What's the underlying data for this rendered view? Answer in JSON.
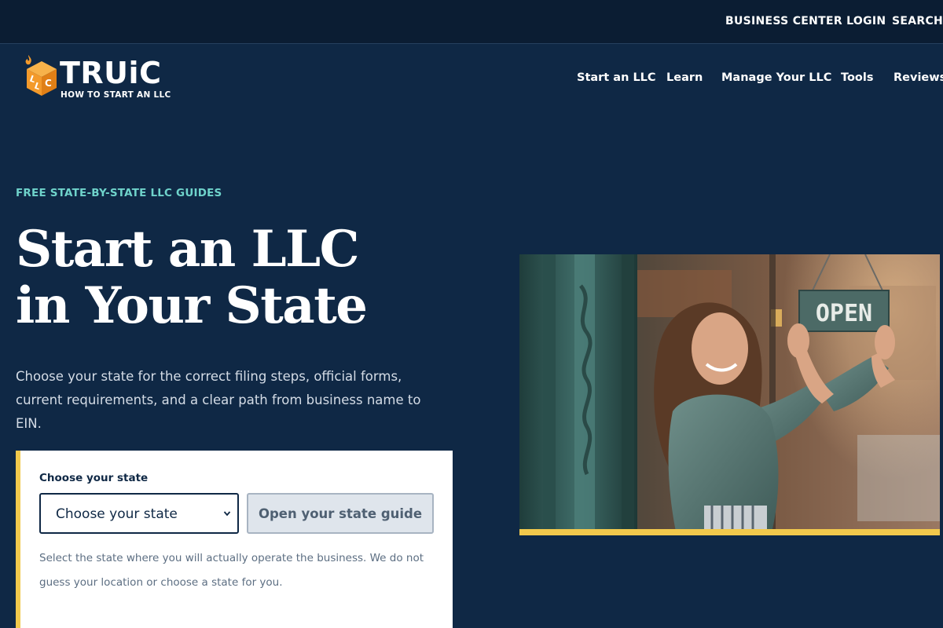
{
  "utility_nav": {
    "login": "BUSINESS CENTER LOGIN",
    "search": "SEARCH"
  },
  "logo": {
    "wordmark": "TRUiC",
    "tagline": "HOW TO START AN LLC",
    "cube_letters": "LLC"
  },
  "main_nav": {
    "items": [
      "Start an LLC",
      "Learn",
      "Manage Your LLC",
      "Tools",
      "Reviews"
    ]
  },
  "hero": {
    "eyebrow": "FREE STATE-BY-STATE LLC GUIDES",
    "headline_line1": "Start an LLC",
    "headline_line2": "in Your State",
    "intro": "Choose your state for the correct filing steps, official forms, current requirements, and a clear path from business name to EIN."
  },
  "state_picker": {
    "label": "Choose your state",
    "select_value": "Choose your state",
    "button": "Open your state guide",
    "help": "Select the state where you will actually operate the business. We do not guess your location or choose a state for you."
  },
  "photo": {
    "sign_text": "OPEN"
  },
  "colors": {
    "page_bg": "#0f2845",
    "topbar_bg": "#0b1d33",
    "accent_teal": "#6fd3cb",
    "accent_yellow": "#f2c94c",
    "logo_orange": "#f39a2b"
  }
}
